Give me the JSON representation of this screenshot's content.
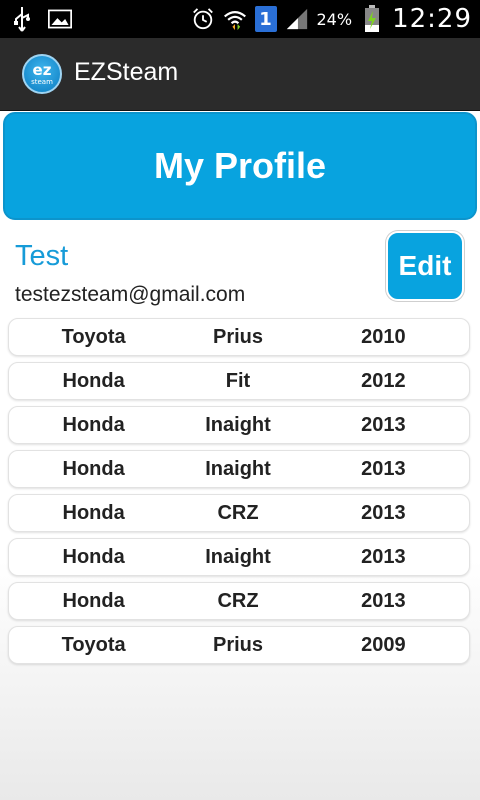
{
  "status_bar": {
    "battery_percent": "24%",
    "time": "12:29",
    "notification_badge": "1",
    "icons": [
      "usb-icon",
      "image-icon",
      "alarm-icon",
      "wifi-icon",
      "signal-icon",
      "battery-charging-icon"
    ]
  },
  "app": {
    "title": "EZSteam",
    "logo_text": "ez",
    "logo_subtext": "steam"
  },
  "banner": {
    "title": "My Profile"
  },
  "profile": {
    "name": "Test",
    "email": "testezsteam@gmail.com",
    "edit_label": "Edit"
  },
  "vehicles": [
    {
      "make": "Toyota",
      "model": "Prius",
      "year": "2010"
    },
    {
      "make": "Honda",
      "model": "Fit",
      "year": "2012"
    },
    {
      "make": "Honda",
      "model": "Inaight",
      "year": "2013"
    },
    {
      "make": "Honda",
      "model": "Inaight",
      "year": "2013"
    },
    {
      "make": "Honda",
      "model": "CRZ",
      "year": "2013"
    },
    {
      "make": "Honda",
      "model": "Inaight",
      "year": "2013"
    },
    {
      "make": "Honda",
      "model": "CRZ",
      "year": "2013"
    },
    {
      "make": "Toyota",
      "model": "Prius",
      "year": "2009"
    }
  ],
  "colors": {
    "accent": "#08a3df",
    "name_text": "#169bd8",
    "action_bar": "#2b2b2b"
  }
}
